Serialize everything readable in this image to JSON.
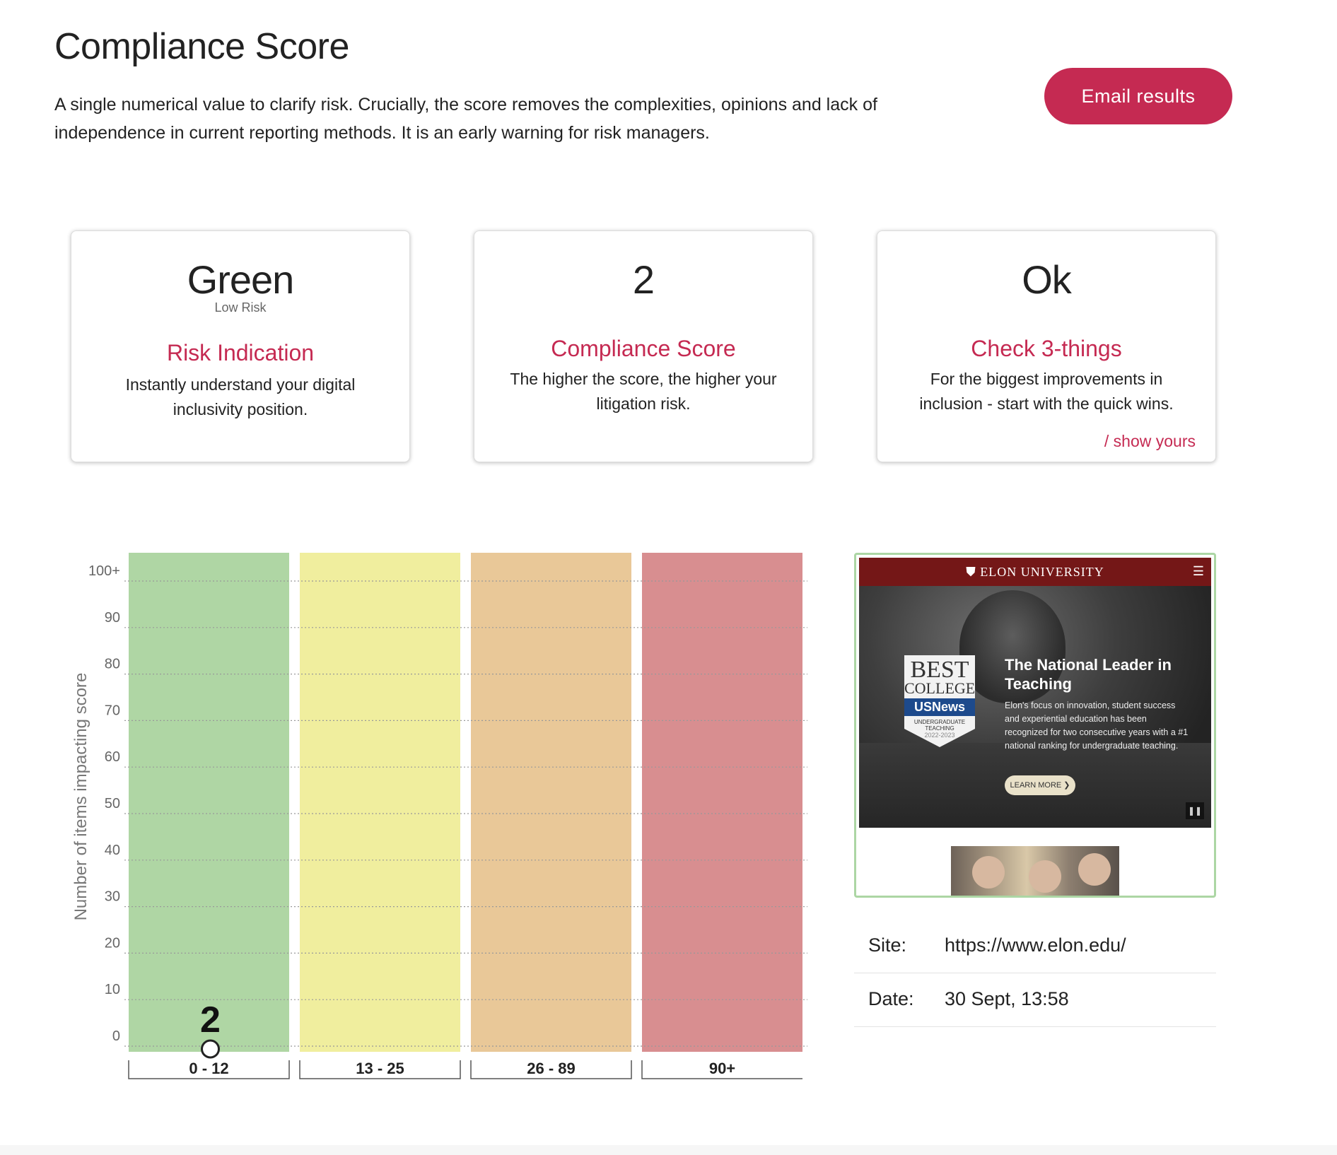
{
  "header": {
    "title": "Compliance Score",
    "description": "A single numerical value to clarify risk. Crucially, the score removes the complexities, opinions and lack of independence in current reporting methods. It is an early warning for risk managers.",
    "email_button": "Email results"
  },
  "cards": [
    {
      "value": "Green",
      "sub": "Low Risk",
      "title": "Risk Indication",
      "text": "Instantly understand your digital inclusivity position."
    },
    {
      "value": "2",
      "title": "Compliance Score",
      "text": "The higher the score, the higher your litigation risk."
    },
    {
      "value": "Ok",
      "title": "Check 3-things",
      "text": "For the biggest improvements in inclusion - start with the quick wins.",
      "link": "/ show yours"
    }
  ],
  "chart_data": {
    "type": "bar",
    "ylabel": "Number of items impacting score",
    "yticks": [
      "0",
      "10",
      "20",
      "30",
      "40",
      "50",
      "60",
      "70",
      "80",
      "90",
      "100+"
    ],
    "ylim": [
      0,
      100
    ],
    "grid": true,
    "bands": [
      {
        "label": "0 - 12",
        "color": "#afd6a4"
      },
      {
        "label": "13 - 25",
        "color": "#f0ee9e"
      },
      {
        "label": "26 - 89",
        "color": "#e9c898"
      },
      {
        "label": "90+",
        "color": "#d88e90"
      }
    ],
    "marker": {
      "band": 0,
      "y": 0,
      "label": "2"
    }
  },
  "site_screenshot": {
    "brand": "ELON UNIVERSITY",
    "headline": "The National Leader in Teaching",
    "body": "Elon's focus on innovation, student success and experiential education has been recognized for two consecutive years with a #1 national ranking for undergraduate teaching.",
    "cta": "LEARN MORE ❯",
    "badge_line1": "BEST",
    "badge_line2": "COLLEGES",
    "badge_line3": "USNews",
    "badge_line4": "UNDERGRADUATE TEACHING",
    "badge_line5": "2022-2023"
  },
  "info": {
    "site_label": "Site:",
    "site_value": "https://www.elon.edu/",
    "date_label": "Date:",
    "date_value": "30 Sept, 13:58"
  }
}
